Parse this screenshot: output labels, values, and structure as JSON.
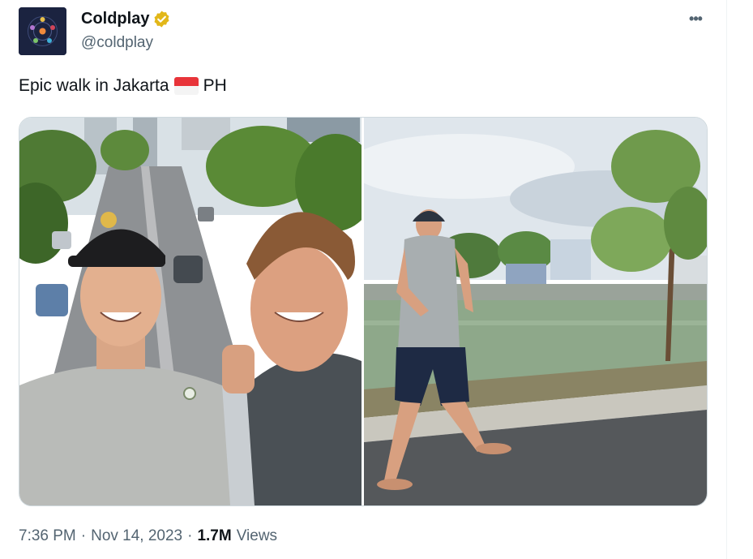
{
  "author": {
    "display_name": "Coldplay",
    "handle": "@coldplay",
    "verified": true,
    "avatar_icon": "coldplay-avatar-icon",
    "verified_badge_color": "#e2b719"
  },
  "more_menu": {
    "label": "•••",
    "icon": "more-options-icon"
  },
  "tweet": {
    "text_before": "Epic walk in Jakarta",
    "flag_icon": "indonesia-flag-icon",
    "flag_colors": {
      "top": "#e8343a",
      "bottom": "#f4f4f4"
    },
    "text_after": "PH"
  },
  "media": {
    "photos": [
      {
        "name": "selfie-photo"
      },
      {
        "name": "walking-photo"
      }
    ]
  },
  "meta": {
    "time": "7:36 PM",
    "separator": "·",
    "date": "Nov 14, 2023",
    "views_count": "1.7M",
    "views_label": "Views"
  }
}
